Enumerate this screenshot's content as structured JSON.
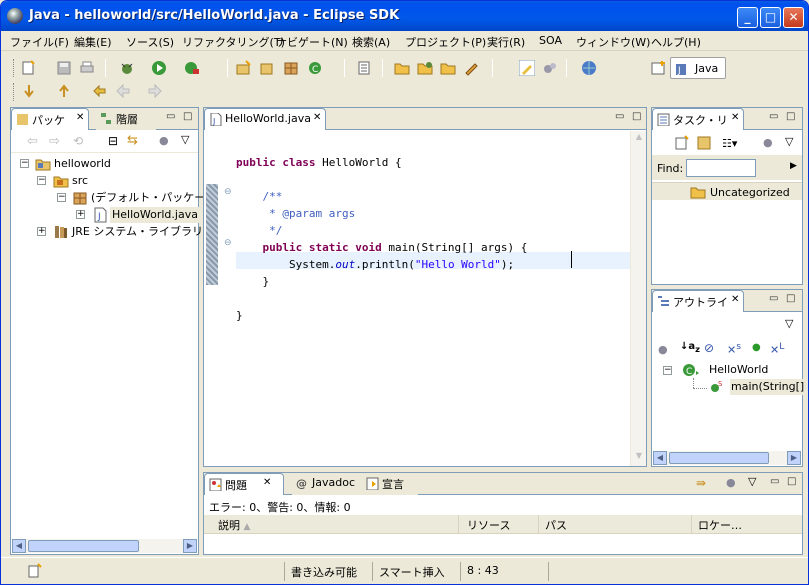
{
  "window": {
    "title": "Java - helloworld/src/HelloWorld.java - Eclipse SDK",
    "min": "_",
    "max": "□",
    "close": "✕"
  },
  "menu": [
    "ファイル(F)",
    "編集(E)",
    "ソース(S)",
    "リファクタリング(T)",
    "ナビゲート(N)",
    "検索(A)",
    "プロジェクト(P)",
    "実行(R)",
    "SOA",
    "ウィンドウ(W)",
    "ヘルプ(H)"
  ],
  "perspective": {
    "label": "Java"
  },
  "package_explorer": {
    "tabs": [
      {
        "label": "パッケ"
      },
      {
        "label": "階層"
      }
    ],
    "tree": [
      {
        "label": "helloworld",
        "expander": "−"
      },
      {
        "label": "src",
        "expander": "−"
      },
      {
        "label": "(デフォルト・パッケージ)",
        "expander": "−"
      },
      {
        "label": "HelloWorld.java",
        "expander": "+"
      },
      {
        "label": "JRE システム・ライブラリー",
        "expander": "+"
      }
    ]
  },
  "editor": {
    "tab": "HelloWorld.java",
    "lines": [
      {
        "parts": [
          {
            "t": "public class ",
            "c": "kw"
          },
          {
            "t": "HelloWorld {",
            "c": ""
          }
        ]
      },
      {
        "parts": []
      },
      {
        "parts": [
          {
            "t": "    /**",
            "c": "cm"
          }
        ]
      },
      {
        "parts": [
          {
            "t": "     * @param args",
            "c": "cm"
          }
        ]
      },
      {
        "parts": [
          {
            "t": "     */",
            "c": "cm"
          }
        ]
      },
      {
        "parts": [
          {
            "t": "    public static void ",
            "c": "kw"
          },
          {
            "t": "main(String[] args) {",
            "c": ""
          }
        ]
      },
      {
        "parts": [
          {
            "t": "        System.",
            "c": ""
          },
          {
            "t": "out",
            "c": "it"
          },
          {
            "t": ".println(",
            "c": ""
          },
          {
            "t": "\"Hello World\"",
            "c": "st"
          },
          {
            "t": ");",
            "c": ""
          }
        ]
      },
      {
        "parts": [
          {
            "t": "    }",
            "c": ""
          }
        ]
      },
      {
        "parts": []
      },
      {
        "parts": [
          {
            "t": "}",
            "c": ""
          }
        ]
      }
    ]
  },
  "tasklist": {
    "tab": "タスク・リ",
    "find_label": "Find:",
    "find_value": "",
    "category": "Uncategorized"
  },
  "outline": {
    "tab": "アウトライ",
    "class_name": "HelloWorld",
    "method": "main(String[]"
  },
  "problems": {
    "tabs": [
      {
        "label": "問題"
      },
      {
        "label": "Javadoc"
      },
      {
        "label": "宣言"
      }
    ],
    "summary": "エラー: 0、警告: 0、情報: 0",
    "columns": [
      "説明",
      "リソース",
      "パス",
      "ロケー…"
    ]
  },
  "status": {
    "writable": "書き込み可能",
    "insert": "スマート挿入",
    "position": "8 : 43"
  }
}
